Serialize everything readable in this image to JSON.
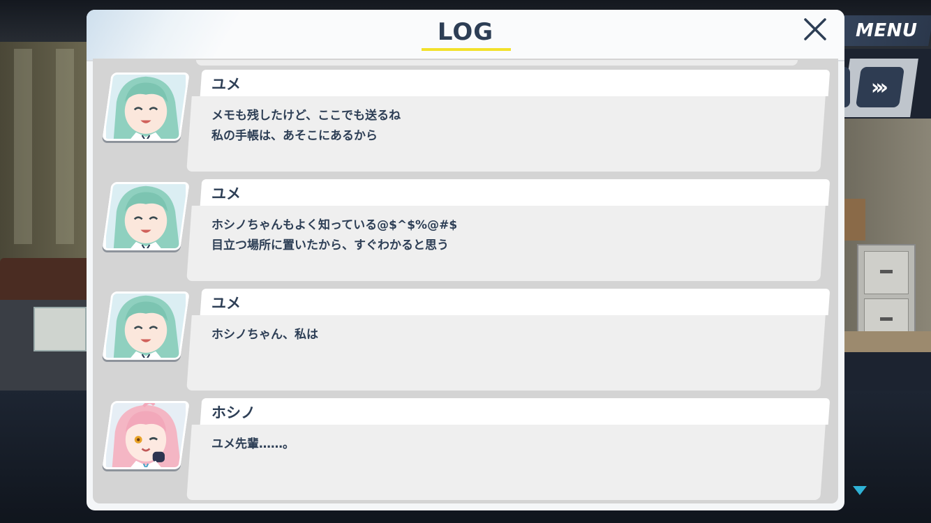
{
  "hud": {
    "menu_label": "MENU",
    "fast_forward_label": "»"
  },
  "log": {
    "title": "LOG",
    "entries": [
      {
        "speaker": "ユメ",
        "lines": [
          "メモも残したけど、ここでも送るね",
          "私の手帳は、あそこにあるから"
        ]
      },
      {
        "speaker": "ユメ",
        "lines": [
          "ホシノちゃんもよく知っている@$^$%@#$",
          "目立つ場所に置いたから、すぐわかると思う"
        ]
      },
      {
        "speaker": "ユメ",
        "lines": [
          "ホシノちゃん、私は"
        ]
      },
      {
        "speaker": "ホシノ",
        "lines": [
          "ユメ先輩……。"
        ]
      }
    ]
  },
  "colors": {
    "title_text": "#2d3e55",
    "title_underline": "#f2e12b",
    "menu_bg": "#34435a",
    "scroll_arrow": "#2fb2d6"
  },
  "icons": {
    "close": "close-icon",
    "fast_forward": "fast-forward-icon",
    "scroll_down": "triangle-down-icon"
  }
}
